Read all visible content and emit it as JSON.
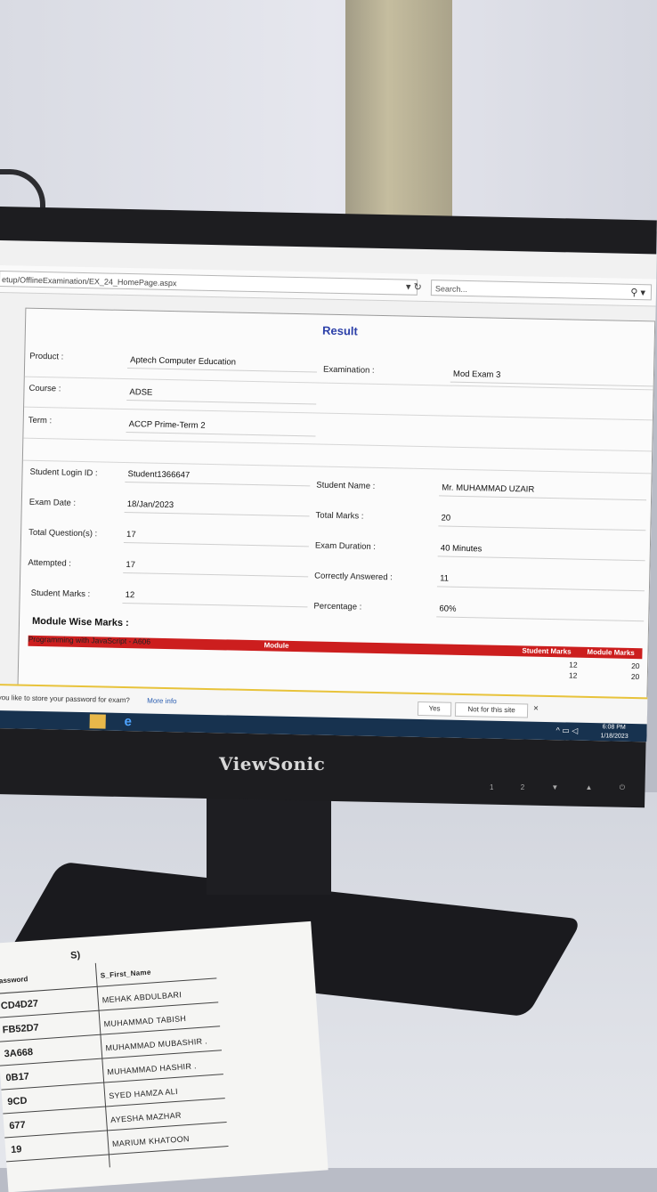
{
  "browser": {
    "url": "etup/OfflineExamination/EX_24_HomePage.aspx",
    "search_placeholder": "Search..."
  },
  "result": {
    "title": "Result",
    "product_label": "Product :",
    "product_value": "Aptech Computer Education",
    "examination_label": "Examination :",
    "examination_value": "Mod Exam 3",
    "course_label": "Course :",
    "course_value": "ADSE",
    "term_label": "Term :",
    "term_value": "ACCP Prime-Term 2",
    "login_label": "Student Login ID :",
    "login_value": "Student1366647",
    "name_label": "Student Name :",
    "name_value": "Mr. MUHAMMAD UZAIR",
    "date_label": "Exam Date :",
    "date_value": "18/Jan/2023",
    "total_marks_label": "Total Marks :",
    "total_marks_value": "20",
    "questions_label": "Total Question(s) :",
    "questions_value": "17",
    "duration_label": "Exam Duration :",
    "duration_value": "40 Minutes",
    "attempted_label": "Attempted :",
    "attempted_value": "17",
    "correct_label": "Correctly Answered :",
    "correct_value": "11",
    "student_marks_label": "Student Marks :",
    "student_marks_value": "12",
    "percentage_label": "Percentage :",
    "percentage_value": "60%"
  },
  "module": {
    "heading": "Module Wise Marks :",
    "col_module": "Module",
    "col_student_marks": "Student Marks",
    "col_module_marks": "Module Marks",
    "row_name": "Programming with JavaScript - A606",
    "row_student_marks": "12",
    "row_module_marks": "20",
    "total_student_marks": "12",
    "total_module_marks": "20"
  },
  "password_bar": {
    "prompt": "ld you like to store your password for exam?",
    "more_info": "More info",
    "yes_label": "Yes",
    "no_label": "Not for this site",
    "close": "×"
  },
  "taskbar": {
    "time": "6:08 PM",
    "date": "1/18/2023"
  },
  "monitor": {
    "brand": "ViewSonic",
    "buttons": [
      "1",
      "2",
      "▼",
      "▲",
      "⏻"
    ]
  },
  "paper": {
    "header_partial": "S)",
    "col_password": "assword",
    "col_name": "S_First_Name",
    "rows": [
      {
        "pw": "CD4D27",
        "name": "MEHAK ABDULBARI"
      },
      {
        "pw": "FB52D7",
        "name": "MUHAMMAD TABISH"
      },
      {
        "pw": "3A668",
        "name": "MUHAMMAD MUBASHIR ."
      },
      {
        "pw": "0B17",
        "name": "MUHAMMAD HASHIR ."
      },
      {
        "pw": "9CD",
        "name": "SYED HAMZA ALI"
      },
      {
        "pw": "677",
        "name": "AYESHA MAZHAR"
      },
      {
        "pw": "19",
        "name": "MARIUM KHATOON"
      }
    ]
  }
}
